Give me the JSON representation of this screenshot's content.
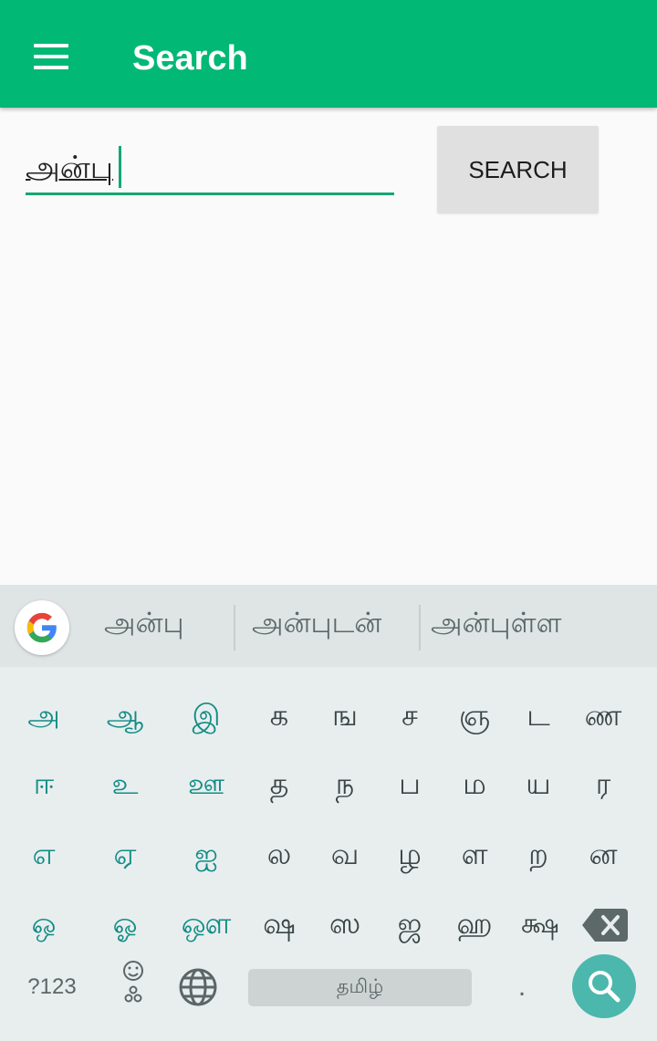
{
  "app_bar": {
    "title": "Search",
    "menu_icon": "hamburger-menu-icon"
  },
  "search": {
    "value": "அன்பு",
    "button_label": "SEARCH"
  },
  "keyboard": {
    "suggestions": [
      "அன்பு",
      "அன்புடன்",
      "அன்புள்ள"
    ],
    "rows": [
      [
        "அ",
        "ஆ",
        "இ",
        "க",
        "ங",
        "ச",
        "ஞ",
        "ட",
        "ண"
      ],
      [
        "ஈ",
        "உ",
        "ஊ",
        "த",
        "ந",
        "ப",
        "ம",
        "ய",
        "ர"
      ],
      [
        "எ",
        "ஏ",
        "ஐ",
        "ல",
        "வ",
        "ழ",
        "ள",
        "ற",
        "ன"
      ],
      [
        "ஒ",
        "ஓ",
        "ஔ",
        "ஷ",
        "ஸ",
        "ஜ",
        "ஹ",
        "க்ஷ"
      ]
    ],
    "symbols_label": "?123",
    "space_label": "தமிழ்",
    "period_label": ".",
    "accent": "#138c86",
    "search_key_color": "#4cb7ac"
  }
}
